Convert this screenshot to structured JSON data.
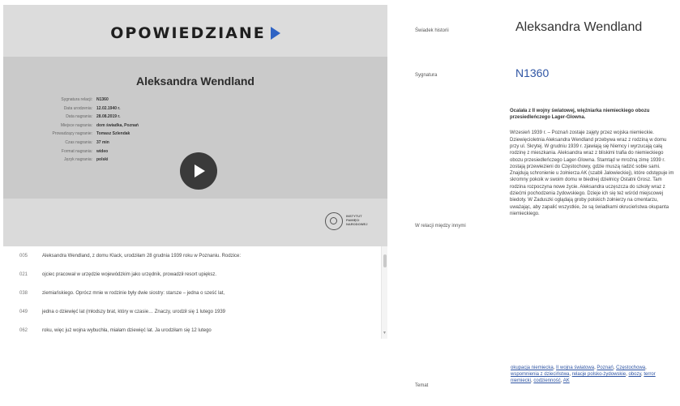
{
  "player": {
    "brand": "OPOWIEDZIANE",
    "card_title": "Aleksandra Wendland",
    "meta": [
      {
        "label": "Sygnatura relacji:",
        "value": "N1360"
      },
      {
        "label": "Data urodzenia:",
        "value": "12.02.1940 r."
      },
      {
        "label": "Data nagrania:",
        "value": "28.08.2019 r."
      },
      {
        "label": "Miejsce nagrania:",
        "value": "dom świadka, Poznań"
      },
      {
        "label": "Prowadzący nagranie:",
        "value": "Tomasz Szlendak"
      },
      {
        "label": "Czas nagrania:",
        "value": "37 min"
      },
      {
        "label": "Format nagrania:",
        "value": "wideo"
      },
      {
        "label": "Język nagrania:",
        "value": "polski"
      }
    ],
    "institution": [
      "INSTYTUT",
      "PAMIĘCI",
      "NARODOWEJ"
    ]
  },
  "transcript": [
    {
      "time": "005",
      "text": "Aleksandra Wendland, z domu Klack, urodziłam 28 grudnia 1939 roku w Poznaniu. Rodzice:"
    },
    {
      "time": "021",
      "text": "ojciec pracował w urzędzie wojewódzkim jako urzędnik, prowadził resort upiększ."
    },
    {
      "time": "038",
      "text": "ziemiańskiego. Oprócz mnie w rodzinie były dwie siostry: starsze – jedna o sześć lat,"
    },
    {
      "time": "049",
      "text": "jedna o dziewięć lat (młodszy brat, który w czasie… Znaczy, urodził się 1 lutego 1939"
    },
    {
      "time": "062",
      "text": "roku, więc już wojna wybuchła, miałam dziewięć lat. Ja urodziłam się 12 lutego"
    }
  ],
  "details": {
    "witness_label": "Świadek historii",
    "witness_value": "Aleksandra Wendland",
    "signature_label": "Sygnatura",
    "signature_value": "N1360",
    "summary_label": "W relacji między innymi",
    "summary_head": "Ocalała z II wojny światowej, więźniarka niemieckiego obozu przesiedleńczego Lager-Glowna.",
    "summary_text": "Wrzesień 1939 r. – Poznań zostaje zajęty przez wojska niemieckie. Dziewięcioletnia Aleksandra Wendland przebywa wraz z rodziną w domu przy ul. Skrytej. W grudniu 1939 r. zjawiają się Niemcy i wyrzucają całą rodzinę z mieszkania. Aleksandra wraz z bliskimi trafia do niemieckiego obozu przesiedleńczego Lager-Glowna. Stamtąd w mroźną zimę 1939 r. zostają przewiezieni do Częstochowy, gdzie muszą radzić sobie sami. Znajdują schronienie u żołnierza AK (szabli Jałowieckiej), które odstępuje im skromny pokoik w swoim domu w biednej dzielnicy Ostatni Grosz. Tam rodzina rozpoczyna nowe życie. Aleksandra uczęszcza do szkoły wraz z dziećmi pochodzenia żydowskiego. Dzieje ich się też wśród miejscowej biedoty. W Zaduszki oglądają groby polskich żołnierzy na cmentarzu, uważając, aby zapalić wszystkie, że są świadkami okrucieństwa okupanta niemieckiego.",
    "topic_label": "Temat",
    "topics": [
      "okupacja niemiecka",
      "II wojna światowa",
      "Poznań",
      "Częstochowa",
      "wspomnienia z dzieciństwa",
      "relacje polsko-żydowskie",
      "obozy",
      "terror niemiecki",
      "codzienność",
      "AK"
    ]
  }
}
